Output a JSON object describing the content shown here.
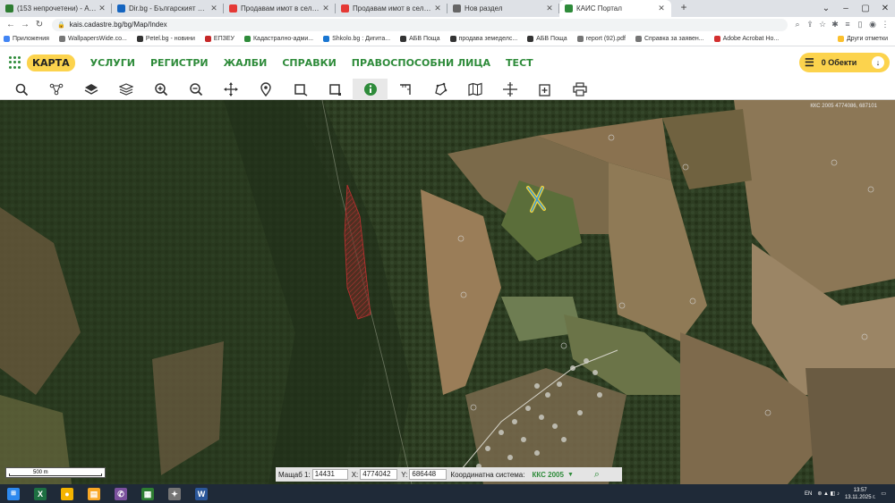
{
  "browser": {
    "tabs": [
      {
        "title": "(153 непрочетени) - АБВ поща",
        "color": "#2e7d32",
        "active": false
      },
      {
        "title": "Dir.bg - Българският Интернет",
        "color": "#1565c0",
        "active": false
      },
      {
        "title": "Продавам имот в село Юнак -",
        "color": "#e53935",
        "active": false
      },
      {
        "title": "Продавам имот в село Шкорп",
        "color": "#e53935",
        "active": false
      },
      {
        "title": "Нов раздел",
        "color": "#666666",
        "active": false
      },
      {
        "title": "КАИС Портал",
        "color": "#2e8b3a",
        "active": true
      }
    ],
    "address": "kais.cadastre.bg/bg/Map/Index",
    "bookmarks": [
      {
        "label": "Приложения",
        "color": "#4285f4"
      },
      {
        "label": "WallpapersWide.co...",
        "color": "#777777"
      },
      {
        "label": "Petel.bg - новини",
        "color": "#333333"
      },
      {
        "label": "ЕПЗЕУ",
        "color": "#c62828"
      },
      {
        "label": "Кадастрално-адми...",
        "color": "#2e8b3a"
      },
      {
        "label": "Shkolo.bg : Дигита...",
        "color": "#1976d2"
      },
      {
        "label": "АБВ Поща",
        "color": "#333333"
      },
      {
        "label": "продава земеделс...",
        "color": "#333333"
      },
      {
        "label": "АБВ Поща",
        "color": "#333333"
      },
      {
        "label": "report (92).pdf",
        "color": "#757575"
      },
      {
        "label": "Справка за заявен...",
        "color": "#757575"
      },
      {
        "label": "Adobe Acrobat Ho...",
        "color": "#d32f2f"
      }
    ],
    "other_bookmarks": "Други отметки"
  },
  "portal": {
    "nav": [
      "КАРТА",
      "УСЛУГИ",
      "РЕГИСТРИ",
      "ЖАЛБИ",
      "СПРАВКИ",
      "ПРАВОСПОСОБНИ ЛИЦА",
      "ТЕСТ"
    ],
    "objects_label": "0 Обекти"
  },
  "toolbar": {
    "tools": [
      "search-icon",
      "network-icon",
      "layers-icon",
      "layers-stack-icon",
      "zoom-in-icon",
      "zoom-out-icon",
      "pan-icon",
      "marker-icon",
      "select-rect-icon",
      "select-rect-alt-icon",
      "info-icon",
      "measure-distance-icon",
      "polygon-icon",
      "map-icon",
      "crosshair-icon",
      "export-icon",
      "print-icon"
    ],
    "active_tool": "info-icon"
  },
  "map": {
    "coord_readout": "ККС 2005 4774086, 687101",
    "scale_label": "500 m",
    "scale_label_prefix": "Мащаб 1:",
    "scale_value": "14431",
    "x_label": "X:",
    "x_value": "4774042",
    "y_label": "Y:",
    "y_value": "686448",
    "crs_label": "Координатна система:",
    "crs_value": "ККС 2005"
  },
  "taskbar": {
    "apps": [
      {
        "name": "excel",
        "color": "#1d6f42",
        "glyph": "X"
      },
      {
        "name": "chrome",
        "color": "#f4b400",
        "glyph": "●"
      },
      {
        "name": "explorer",
        "color": "#f9a825",
        "glyph": "▤"
      },
      {
        "name": "viber",
        "color": "#7b519d",
        "glyph": "✆"
      },
      {
        "name": "media",
        "color": "#2e7d32",
        "glyph": "▦"
      },
      {
        "name": "tool",
        "color": "#757575",
        "glyph": "✦"
      },
      {
        "name": "word",
        "color": "#2b579a",
        "glyph": "W"
      }
    ],
    "lang": "EN",
    "time": "13:57",
    "date": "13.11.2025 г."
  }
}
